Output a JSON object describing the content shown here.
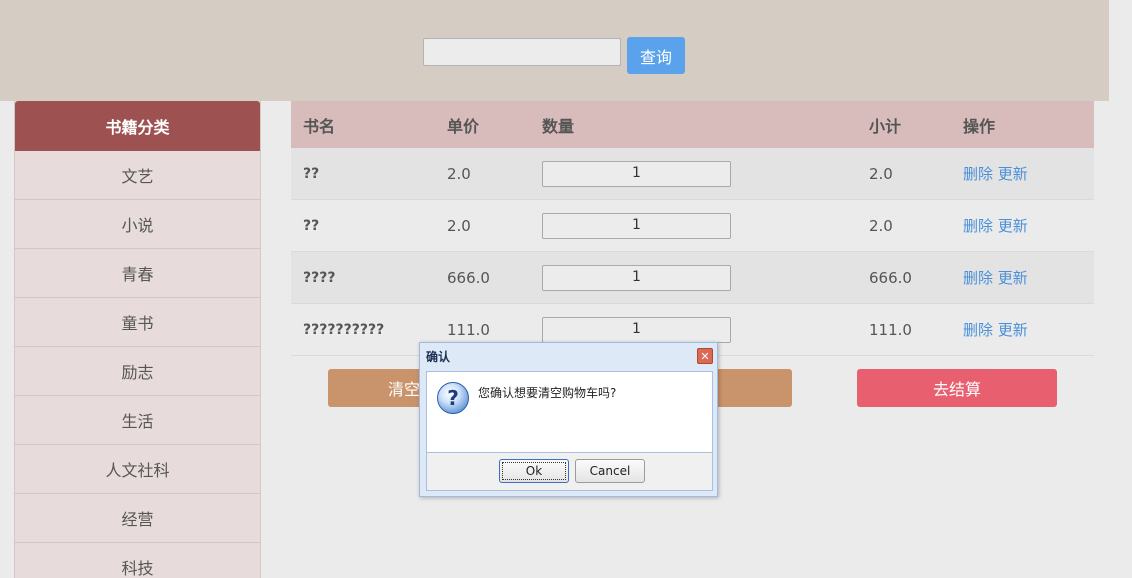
{
  "header": {
    "search_placeholder": "",
    "search_button": "查询"
  },
  "sidebar": {
    "title": "书籍分类",
    "items": [
      "文艺",
      "小说",
      "青春",
      "童书",
      "励志",
      "生活",
      "人文社科",
      "经营",
      "科技"
    ]
  },
  "cart": {
    "columns": [
      "书名",
      "单价",
      "数量",
      "小计",
      "操作"
    ],
    "rows": [
      {
        "name": "??",
        "price": "2.0",
        "qty": "1",
        "subtotal": "2.0",
        "delete": "删除",
        "update": "更新"
      },
      {
        "name": "??",
        "price": "2.0",
        "qty": "1",
        "subtotal": "2.0",
        "delete": "删除",
        "update": "更新"
      },
      {
        "name": "????",
        "price": "666.0",
        "qty": "1",
        "subtotal": "666.0",
        "delete": "删除",
        "update": "更新"
      },
      {
        "name": "??????????",
        "price": "111.0",
        "qty": "1",
        "subtotal": "111.0",
        "delete": "删除",
        "update": "更新"
      }
    ],
    "clear_button": "清空",
    "checkout_button": "去结算"
  },
  "dialog": {
    "title": "确认",
    "message": "您确认想要清空购物车吗?",
    "ok": "Ok",
    "cancel": "Cancel",
    "icon": "question-icon"
  },
  "colors": {
    "topbar": "#d5ccc4",
    "sidebar_header": "#9d5251",
    "table_header": "#d8bcbb",
    "search_button": "#5aa3ec",
    "clear_button": "#c9936b",
    "checkout_button": "#e86070",
    "link": "#4a90d9"
  }
}
